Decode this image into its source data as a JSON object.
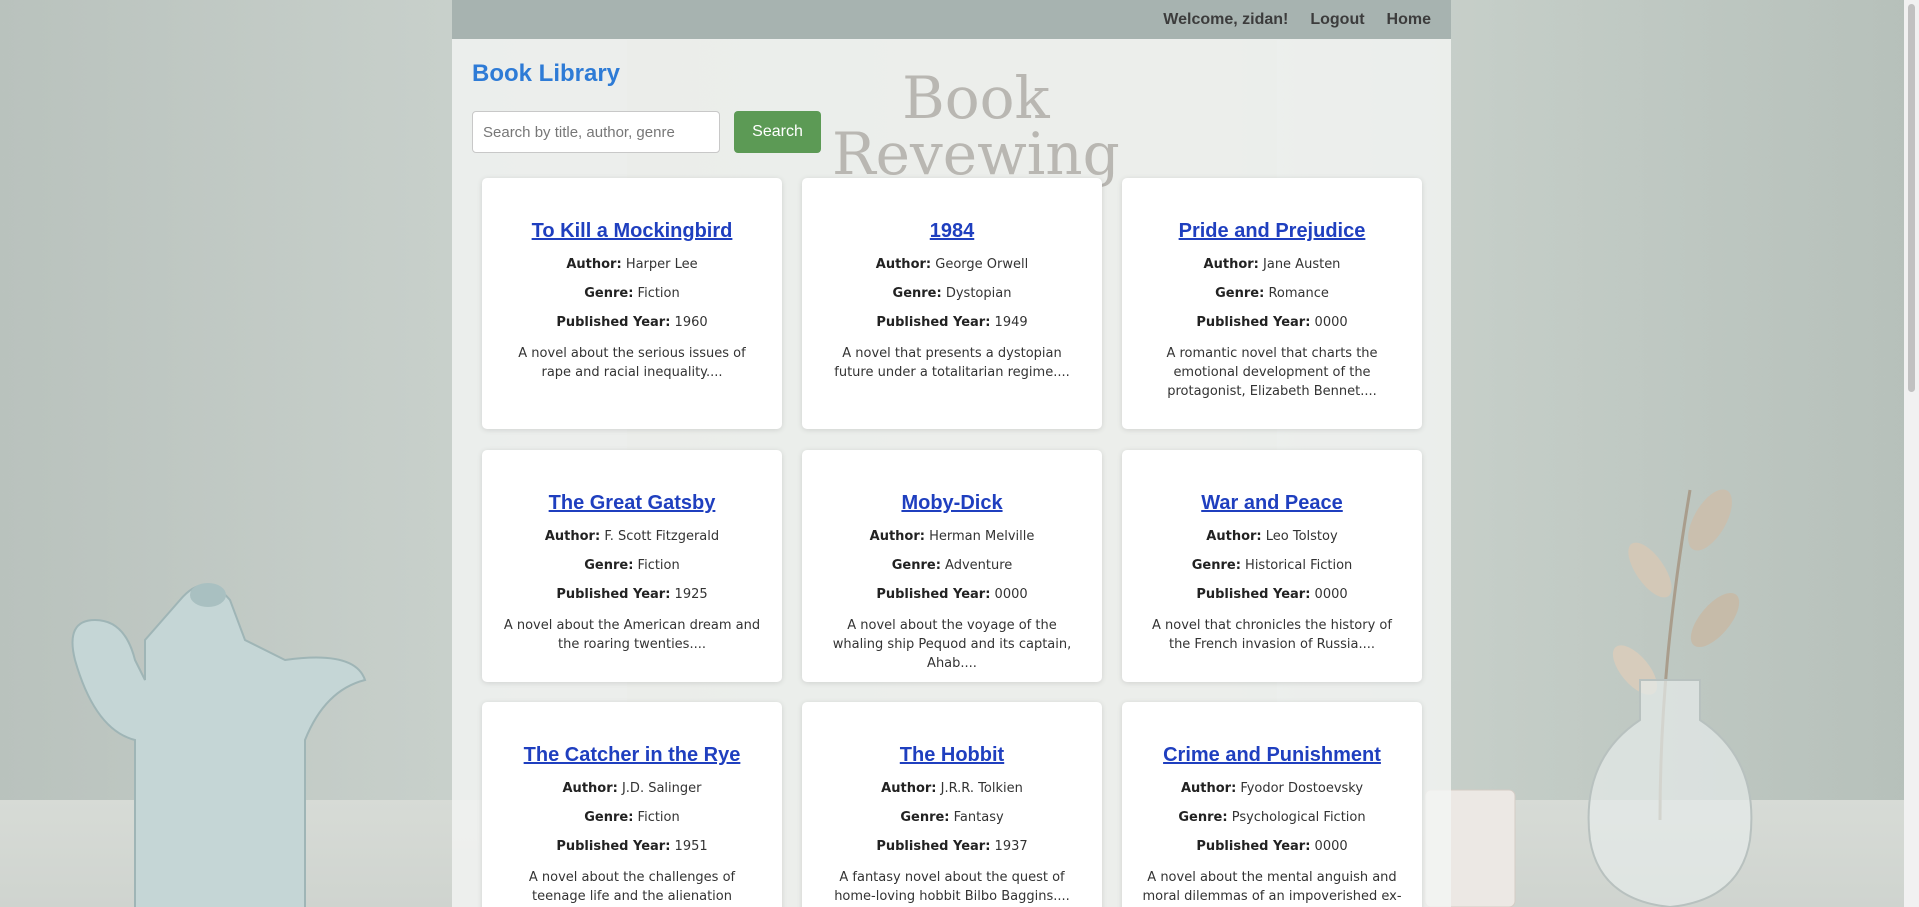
{
  "nav": {
    "welcome": "Welcome, zidan!",
    "logout": "Logout",
    "home": "Home"
  },
  "page": {
    "title": "Book Library"
  },
  "search": {
    "placeholder": "Search by title, author, genre",
    "value": "",
    "button": "Search"
  },
  "labels": {
    "author": "Author:",
    "genre": "Genre:",
    "year": "Published Year:"
  },
  "background_text": "Book\nRevewing",
  "books": [
    {
      "title": "To Kill a Mockingbird",
      "author": "Harper Lee",
      "genre": "Fiction",
      "year": "1960",
      "description": "A novel about the serious issues of rape and racial inequality...."
    },
    {
      "title": "1984",
      "author": "George Orwell",
      "genre": "Dystopian",
      "year": "1949",
      "description": "A novel that presents a dystopian future under a totalitarian regime...."
    },
    {
      "title": "Pride and Prejudice",
      "author": "Jane Austen",
      "genre": "Romance",
      "year": "0000",
      "description": "A romantic novel that charts the emotional development of the protagonist, Elizabeth Bennet...."
    },
    {
      "title": "The Great Gatsby",
      "author": "F. Scott Fitzgerald",
      "genre": "Fiction",
      "year": "1925",
      "description": "A novel about the American dream and the roaring twenties...."
    },
    {
      "title": "Moby-Dick",
      "author": "Herman Melville",
      "genre": "Adventure",
      "year": "0000",
      "description": "A novel about the voyage of the whaling ship Pequod and its captain, Ahab...."
    },
    {
      "title": "War and Peace",
      "author": "Leo Tolstoy",
      "genre": "Historical Fiction",
      "year": "0000",
      "description": "A novel that chronicles the history of the French invasion of Russia...."
    },
    {
      "title": "The Catcher in the Rye",
      "author": "J.D. Salinger",
      "genre": "Fiction",
      "year": "1951",
      "description": "A novel about the challenges of teenage life and the alienation experienced by the"
    },
    {
      "title": "The Hobbit",
      "author": "J.R.R. Tolkien",
      "genre": "Fantasy",
      "year": "1937",
      "description": "A fantasy novel about the quest of home-loving hobbit Bilbo Baggins...."
    },
    {
      "title": "Crime and Punishment",
      "author": "Fyodor Dostoevsky",
      "genre": "Psychological Fiction",
      "year": "0000",
      "description": "A novel about the mental anguish and moral dilemmas of an impoverished ex-"
    }
  ],
  "colors": {
    "topbar": "#a7b3b0",
    "title": "#2e7bd6",
    "search_button": "#5c9a55",
    "book_link": "#1f3fbf"
  }
}
